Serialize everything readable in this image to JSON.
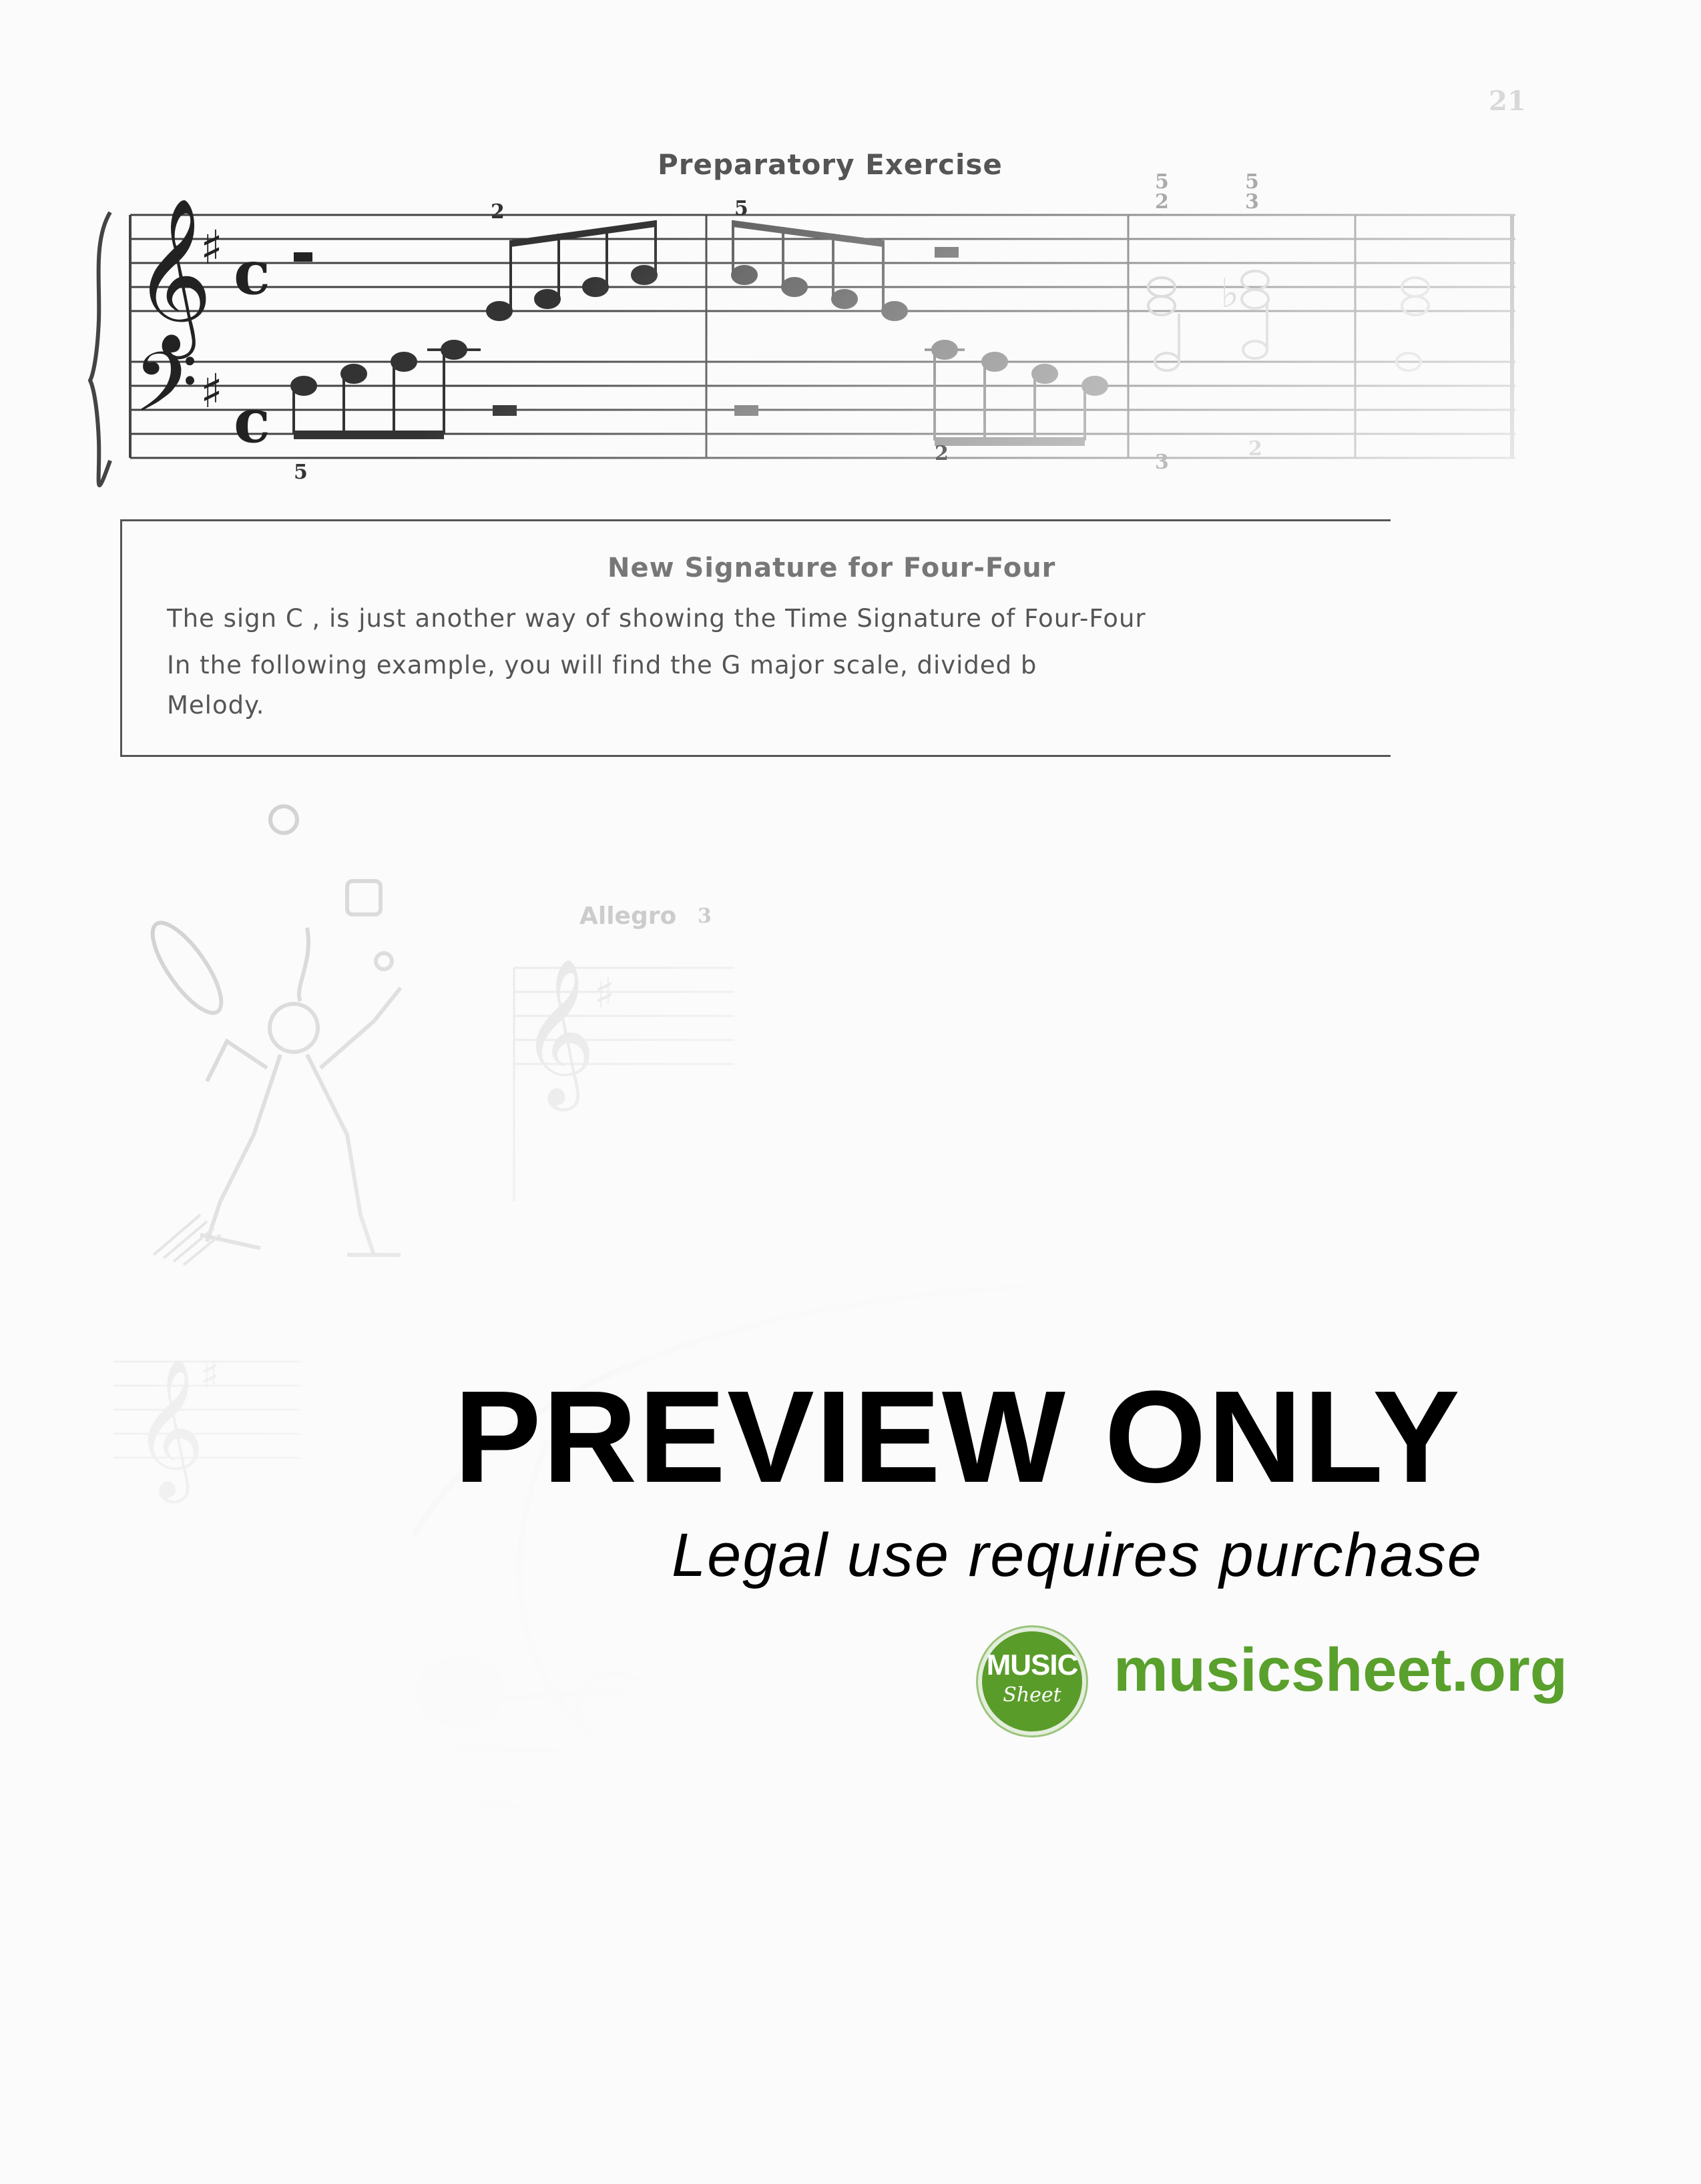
{
  "page": {
    "number": "21"
  },
  "exercise": {
    "title": "Preparatory Exercise",
    "fingerings": {
      "treble_m1": "2",
      "treble_m2": "5",
      "bass_m1": "5",
      "bass_m2": "2",
      "chord_top1": "5",
      "chord_mid1": "2",
      "chord_top2": "5",
      "chord_mid2": "3",
      "bass_m3": "3",
      "bass_m4": "2"
    }
  },
  "info_box": {
    "title": "New Signature for Four-Four",
    "line1": "The sign C , is just another way of showing the Time Signature of Four-Four",
    "line2": "In the following example, you will find the G major scale, divided b",
    "line3": "Melody."
  },
  "second_piece": {
    "tempo": "Allegro",
    "fingering": "3"
  },
  "watermark": {
    "title": "PREVIEW ONLY",
    "subtitle": "Legal use requires purchase",
    "logo_word1": "MUSIC",
    "logo_word2": "Sheet",
    "site": "musicsheet.org",
    "brand_color": "#59a02c"
  }
}
